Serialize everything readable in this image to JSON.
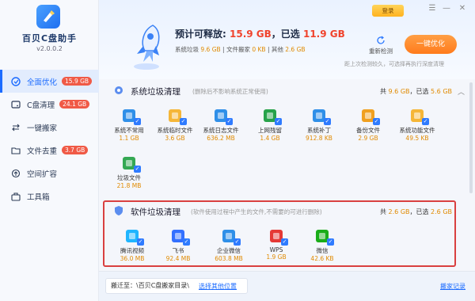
{
  "app": {
    "name": "百贝C盘助手",
    "version": "v2.0.0.2"
  },
  "nav": [
    {
      "label": "全面优化",
      "badge": "15.9 GB",
      "icon": "broom-icon"
    },
    {
      "label": "C盘清理",
      "badge": "24.1 GB",
      "icon": "drive-icon"
    },
    {
      "label": "一键搬家",
      "badge": "",
      "icon": "arrows-icon"
    },
    {
      "label": "文件去重",
      "badge": "3.7 GB",
      "icon": "folder-icon"
    },
    {
      "label": "空间扩容",
      "badge": "",
      "icon": "expand-icon"
    },
    {
      "label": "工具箱",
      "badge": "",
      "icon": "toolbox-icon"
    }
  ],
  "header": {
    "login": "登录",
    "est_label": "预计可释放:",
    "est_value": "15.9 GB",
    "selected_label": "，已选",
    "selected_value": "11.9 GB",
    "sys_label": "系统垃圾",
    "sys_value": "9.6 GB",
    "file_label": "文件搬家",
    "file_value": "0 KB",
    "other_label": "其他",
    "other_value": "2.6 GB",
    "rescan": "重新检测",
    "optimize": "一键优化",
    "hint": "距上次检测较久，可选择再执行深度清理"
  },
  "system": {
    "title": "系统垃圾清理",
    "desc": "(删除后不影响系统正常使用)",
    "total_label": "共",
    "total": "9.6 GB",
    "selected_label": "，已选",
    "selected": "5.6 GB",
    "items": [
      {
        "name": "系统不常用",
        "size": "1.1 GB",
        "icon": "monitor-icon",
        "color": "#2f8fe8"
      },
      {
        "name": "系统临时文件",
        "size": "3.6 GB",
        "icon": "temp-file-icon",
        "color": "#f5b638"
      },
      {
        "name": "系统日志文件",
        "size": "636.2 MB",
        "icon": "log-file-icon",
        "color": "#2f8fe8"
      },
      {
        "name": "上网残留",
        "size": "1.4 GB",
        "icon": "browser-icon",
        "color": "#27a24a"
      },
      {
        "name": "系统补丁",
        "size": "912.8 KB",
        "icon": "patch-icon",
        "color": "#2f8fe8"
      },
      {
        "name": "备份文件",
        "size": "2.9 GB",
        "icon": "backup-icon",
        "color": "#f0a020"
      },
      {
        "name": "系统功能文件",
        "size": "49.5 KB",
        "icon": "feature-file-icon",
        "color": "#f5b638"
      },
      {
        "name": "垃圾文件",
        "size": "21.8 MB",
        "icon": "trash-icon",
        "color": "#34a853"
      }
    ]
  },
  "software": {
    "title": "软件垃圾清理",
    "desc": "(软件使用过程中产生的文件,不需要的可进行删除)",
    "total_label": "共",
    "total": "2.6 GB",
    "selected_label": "，已选",
    "selected": "2.6 GB",
    "items": [
      {
        "name": "腾讯视频",
        "size": "36.0 MB",
        "icon": "tencent-video-icon",
        "color": "#1fb5ff"
      },
      {
        "name": "飞书",
        "size": "92.4 MB",
        "icon": "feishu-icon",
        "color": "#3370ff"
      },
      {
        "name": "企业微信",
        "size": "603.8 MB",
        "icon": "wecom-icon",
        "color": "#2f8fe8"
      },
      {
        "name": "WPS",
        "size": "1.9 GB",
        "icon": "wps-icon",
        "color": "#e53935"
      },
      {
        "name": "微信",
        "size": "42.6 KB",
        "icon": "wechat-icon",
        "color": "#1aad19"
      }
    ]
  },
  "bottom": {
    "move_to_label": "搬迁至：",
    "move_to_path": "\\百贝C盘搬家目录\\",
    "choose": "选择其他位置",
    "records": "搬家记录"
  }
}
